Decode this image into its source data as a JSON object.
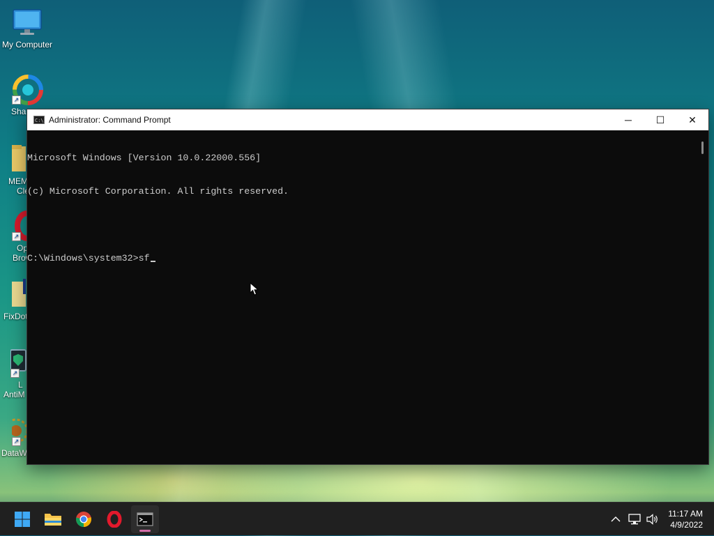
{
  "desktop": {
    "icons": [
      {
        "label": "My Computer",
        "icon": "computer-monitor-icon"
      },
      {
        "label": "Sha",
        "icon": "sharex-icon"
      },
      {
        "label": "MEM",
        "label2": "Cle",
        "icon": "folder-icon"
      },
      {
        "label": "Op",
        "label2": "Brow",
        "icon": "opera-icon"
      },
      {
        "label": "FixDot",
        "icon": "folder-icon"
      },
      {
        "label": "L",
        "label2": "AntiM",
        "icon": "shield-monitor-icon"
      },
      {
        "label": "DataW",
        "icon": "datawipe-icon"
      }
    ]
  },
  "window": {
    "title": "Administrator: Command Prompt",
    "icon": "cmd-icon",
    "controls": {
      "minimize": "─",
      "maximize": "☐",
      "close": "✕"
    },
    "console": {
      "lines": [
        "Microsoft Windows [Version 10.0.22000.556]",
        "(c) Microsoft Corporation. All rights reserved.",
        "",
        "C:\\Windows\\system32>sf"
      ]
    }
  },
  "taskbar": {
    "apps": [
      {
        "name": "start",
        "icon": "windows-logo-icon"
      },
      {
        "name": "file-explorer",
        "icon": "folder-icon"
      },
      {
        "name": "chrome",
        "icon": "chrome-icon"
      },
      {
        "name": "opera",
        "icon": "opera-icon"
      },
      {
        "name": "command-prompt",
        "icon": "cmd-icon",
        "active": true
      }
    ],
    "tray": {
      "overflow": "^",
      "network": "network-icon",
      "volume": "speaker-icon"
    },
    "clock": {
      "time": "11:17 AM",
      "date": "4/9/2022"
    }
  }
}
